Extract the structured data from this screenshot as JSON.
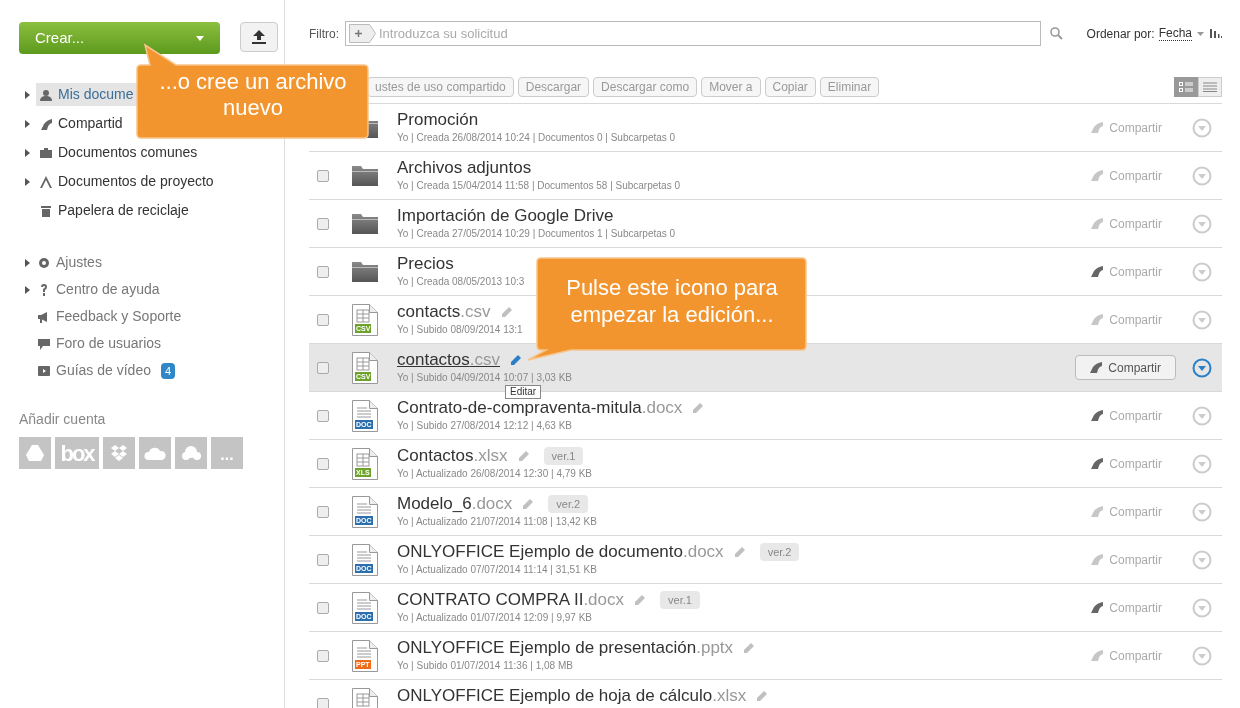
{
  "create_button": {
    "label": "Crear..."
  },
  "sidebar": {
    "folders": [
      {
        "label": "Mis docume",
        "expandable": true,
        "selected": true
      },
      {
        "label": "Compartid",
        "expandable": true,
        "selected": false
      },
      {
        "label": "Documentos comunes",
        "expandable": true,
        "selected": false
      },
      {
        "label": "Documentos de proyecto",
        "expandable": true,
        "selected": false
      },
      {
        "label": "Papelera de reciclaje",
        "expandable": false,
        "selected": false
      }
    ],
    "links": [
      {
        "label": "Ajustes",
        "expandable": true
      },
      {
        "label": "Centro de ayuda",
        "expandable": true
      },
      {
        "label": "Feedback y Soporte",
        "expandable": false
      },
      {
        "label": "Foro de usuarios",
        "expandable": false
      },
      {
        "label": "Guías de vídeo",
        "expandable": false,
        "badge": "4"
      }
    ],
    "add_account": {
      "title": "Añadir cuenta",
      "services": [
        {
          "kind": "drive"
        },
        {
          "kind": "box",
          "text": "box"
        },
        {
          "kind": "dropbox"
        },
        {
          "kind": "onedrive"
        },
        {
          "kind": "cloud"
        },
        {
          "kind": "more",
          "text": "..."
        }
      ]
    }
  },
  "filter": {
    "label": "Filtro:",
    "placeholder": "Introduzca su solicitud"
  },
  "sort": {
    "label": "Ordenar por:",
    "value": "Fecha"
  },
  "toolbar": [
    "ustes de uso compartido",
    "Descargar",
    "Descargar como",
    "Mover a",
    "Copiar",
    "Eliminar"
  ],
  "view_modes": [
    {
      "kind": "detailed",
      "selected": true
    },
    {
      "kind": "compact",
      "selected": false
    }
  ],
  "rows": [
    {
      "kind": "folder",
      "name": "Promoción",
      "meta": "Yo | Creada 26/08/2014 10:24 | Documentos  0 | Subcarpetas 0",
      "share": "Compartir",
      "shared": false,
      "selected": false
    },
    {
      "kind": "folder",
      "name": "Archivos adjuntos",
      "meta": "Yo | Creada 15/04/2014 11:58 | Documentos  58 | Subcarpetas 0",
      "share": "Compartir",
      "shared": false,
      "selected": false
    },
    {
      "kind": "folder",
      "name": "Importación de Google Drive",
      "meta": "Yo | Creada 27/05/2014 10:29 | Documentos  1 | Subcarpetas 0",
      "share": "Compartir",
      "shared": false,
      "selected": false
    },
    {
      "kind": "folder",
      "name": "Precios",
      "meta": "Yo | Creada 08/05/2013 10:3",
      "share": "Compartir",
      "shared": true,
      "selected": false
    },
    {
      "kind": "file",
      "label": "CSV",
      "color": "#6ea32b",
      "name": "contacts",
      "ext": ".csv",
      "meta": "Yo | Subido 08/09/2014 13:1",
      "share": "Compartir",
      "shared": false,
      "selected": false
    },
    {
      "kind": "file",
      "label": "CSV",
      "color": "#6ea32b",
      "name": "contactos",
      "ext": ".csv",
      "meta": "Yo | Subido 04/09/2014 10:07 | 3,03 KB",
      "share": "Compartir",
      "shared": true,
      "selected": true,
      "tooltip": "Editar"
    },
    {
      "kind": "file",
      "label": "DOC",
      "color": "#2c6fae",
      "name": "Contrato-de-compraventa-mitula",
      "ext": ".docx",
      "meta": "Yo | Subido 27/08/2014 12:12 | 4,63 KB",
      "share": "Compartir",
      "shared": true,
      "selected": false
    },
    {
      "kind": "file",
      "label": "XLS",
      "color": "#6ea32b",
      "name": "Contactos",
      "ext": ".xlsx",
      "version": "ver.1",
      "meta": "Yo | Actualizado 26/08/2014 12:30 | 4,79 KB",
      "share": "Compartir",
      "shared": true,
      "selected": false
    },
    {
      "kind": "file",
      "label": "DOC",
      "color": "#2c6fae",
      "name": "Modelo_6",
      "ext": ".docx",
      "version": "ver.2",
      "meta": "Yo | Actualizado 21/07/2014 11:08 | 13,42 KB",
      "share": "Compartir",
      "shared": false,
      "selected": false
    },
    {
      "kind": "file",
      "label": "DOC",
      "color": "#2c6fae",
      "name": "ONLYOFFICE Ejemplo de documento",
      "ext": ".docx",
      "version": "ver.2",
      "meta": "Yo | Actualizado 07/07/2014 11:14 | 31,51 KB",
      "share": "Compartir",
      "shared": false,
      "selected": false
    },
    {
      "kind": "file",
      "label": "DOC",
      "color": "#2c6fae",
      "name": "CONTRATO COMPRA II",
      "ext": ".docx",
      "version": "ver.1",
      "meta": "Yo | Actualizado 01/07/2014 12:09 | 9,97 KB",
      "share": "Compartir",
      "shared": true,
      "selected": false
    },
    {
      "kind": "file",
      "label": "PPT",
      "color": "#ef6b1a",
      "name": "ONLYOFFICE Ejemplo de presentación",
      "ext": ".pptx",
      "meta": "Yo | Subido 01/07/2014 11:36 | 1,08 MB",
      "share": "Compartir",
      "shared": false,
      "selected": false
    },
    {
      "kind": "file",
      "name": "ONLYOFFICE Ejemplo de hoja de cálculo",
      "ext": ".xlsx",
      "selected": false
    }
  ],
  "callouts": [
    {
      "text": "...o cree un archivo nuevo"
    },
    {
      "text": "Pulse este icono para empezar la edición..."
    }
  ]
}
